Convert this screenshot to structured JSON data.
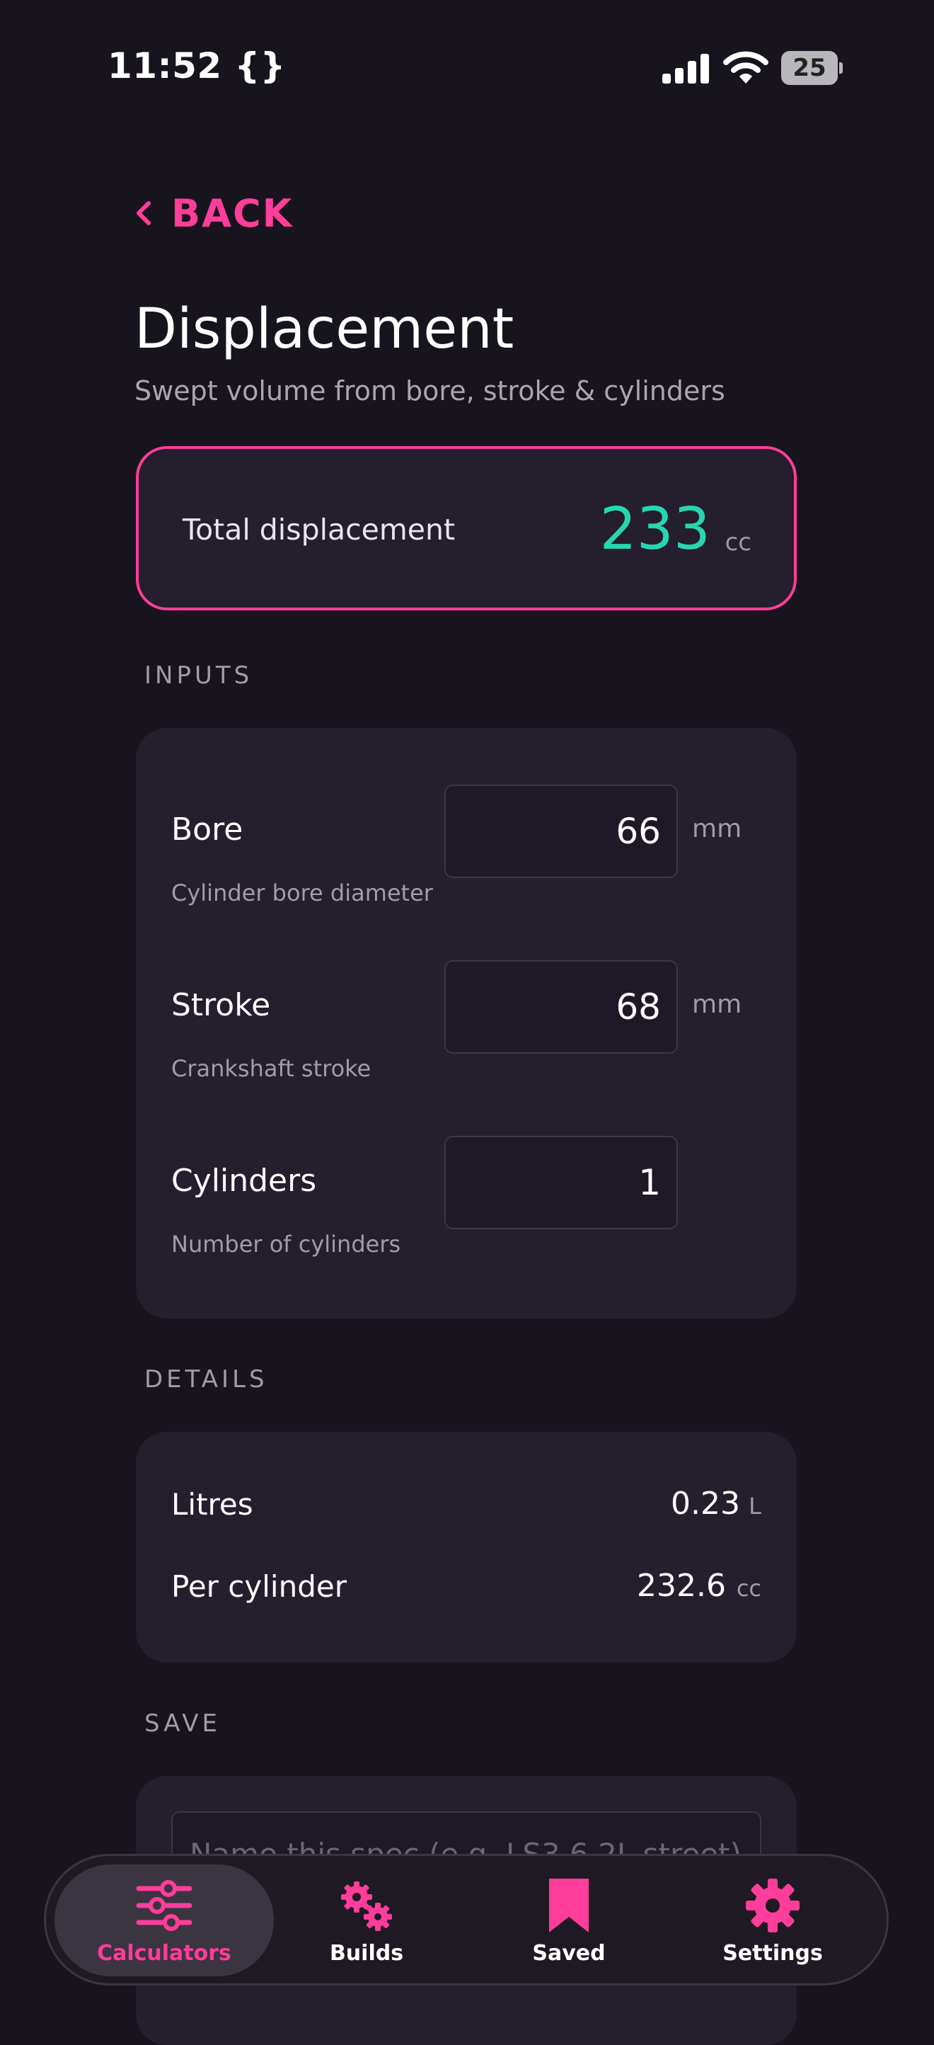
{
  "status_bar": {
    "time": "11:52 {}",
    "battery": "25"
  },
  "header": {
    "back_label": "BACK",
    "title": "Displacement",
    "subtitle": "Swept volume from bore, stroke & cylinders"
  },
  "result": {
    "label": "Total displacement",
    "value": "233",
    "unit": "cc"
  },
  "inputs": {
    "section_label": "INPUTS",
    "rows": [
      {
        "label": "Bore",
        "hint": "Cylinder bore diameter",
        "value": "66",
        "unit": "mm"
      },
      {
        "label": "Stroke",
        "hint": "Crankshaft stroke",
        "value": "68",
        "unit": "mm"
      },
      {
        "label": "Cylinders",
        "hint": "Number of cylinders",
        "value": "1",
        "unit": ""
      }
    ]
  },
  "details": {
    "section_label": "DETAILS",
    "rows": [
      {
        "label": "Litres",
        "value": "0.23",
        "unit": "L"
      },
      {
        "label": "Per cylinder",
        "value": "232.6",
        "unit": "cc"
      }
    ]
  },
  "save": {
    "section_label": "SAVE",
    "placeholder": "Name this spec (e.g. LS3 6.2L street)"
  },
  "tabbar": {
    "tabs": [
      {
        "label": "Calculators",
        "icon": "sliders-icon",
        "active": true
      },
      {
        "label": "Builds",
        "icon": "gears-icon",
        "active": false
      },
      {
        "label": "Saved",
        "icon": "bookmark-icon",
        "active": false
      },
      {
        "label": "Settings",
        "icon": "gear-icon",
        "active": false
      }
    ]
  },
  "colors": {
    "accent": "#ff3d9a",
    "result": "#27d6b0",
    "background": "#18141d",
    "card": "#241e2d"
  }
}
